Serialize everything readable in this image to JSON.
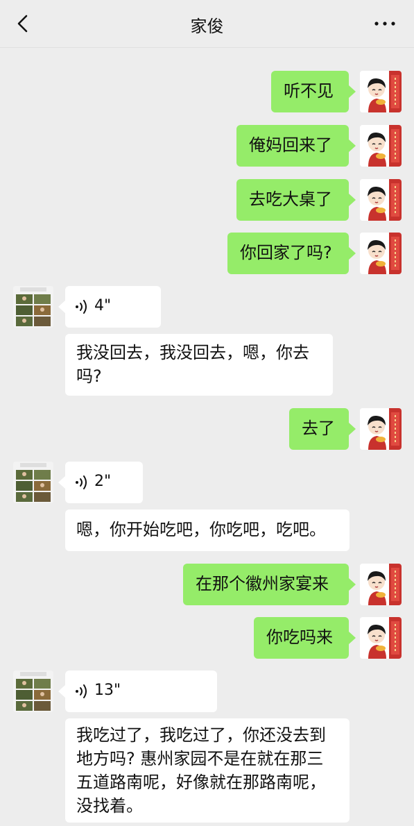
{
  "header": {
    "title": "家俊"
  },
  "colors": {
    "sent_bubble": "#95ec69",
    "received_bubble": "#ffffff",
    "background": "#ededed"
  },
  "icons": {
    "back": "chevron-left-icon",
    "more": "more-dots-icon",
    "voice": "voice-wave-icon"
  },
  "messages": [
    {
      "from": "me",
      "type": "text",
      "text": "听不见"
    },
    {
      "from": "me",
      "type": "text",
      "text": "俺妈回来了"
    },
    {
      "from": "me",
      "type": "text",
      "text": "去吃大桌了"
    },
    {
      "from": "me",
      "type": "text",
      "text": "你回家了吗?"
    },
    {
      "from": "friend",
      "type": "voice",
      "duration": "4\""
    },
    {
      "from": "friend",
      "type": "text",
      "lines": [
        "我没回去，我没回去，嗯，你去",
        "吗?"
      ]
    },
    {
      "from": "me",
      "type": "text",
      "text": "去了"
    },
    {
      "from": "friend",
      "type": "voice",
      "duration": "2\""
    },
    {
      "from": "friend",
      "type": "text",
      "text": "嗯，你开始吃吧，你吃吧，吃吧。"
    },
    {
      "from": "me",
      "type": "text",
      "text": "在那个徽州家宴来"
    },
    {
      "from": "me",
      "type": "text",
      "text": "你吃吗来"
    },
    {
      "from": "friend",
      "type": "voice",
      "duration": "13\""
    },
    {
      "from": "friend",
      "type": "text",
      "lines": [
        "我吃过了，我吃过了，你还没去到",
        "地方吗? 惠州家园不是在就在那三",
        "五道路南呢，好像就在那路南呢，",
        "没找着。"
      ]
    }
  ]
}
